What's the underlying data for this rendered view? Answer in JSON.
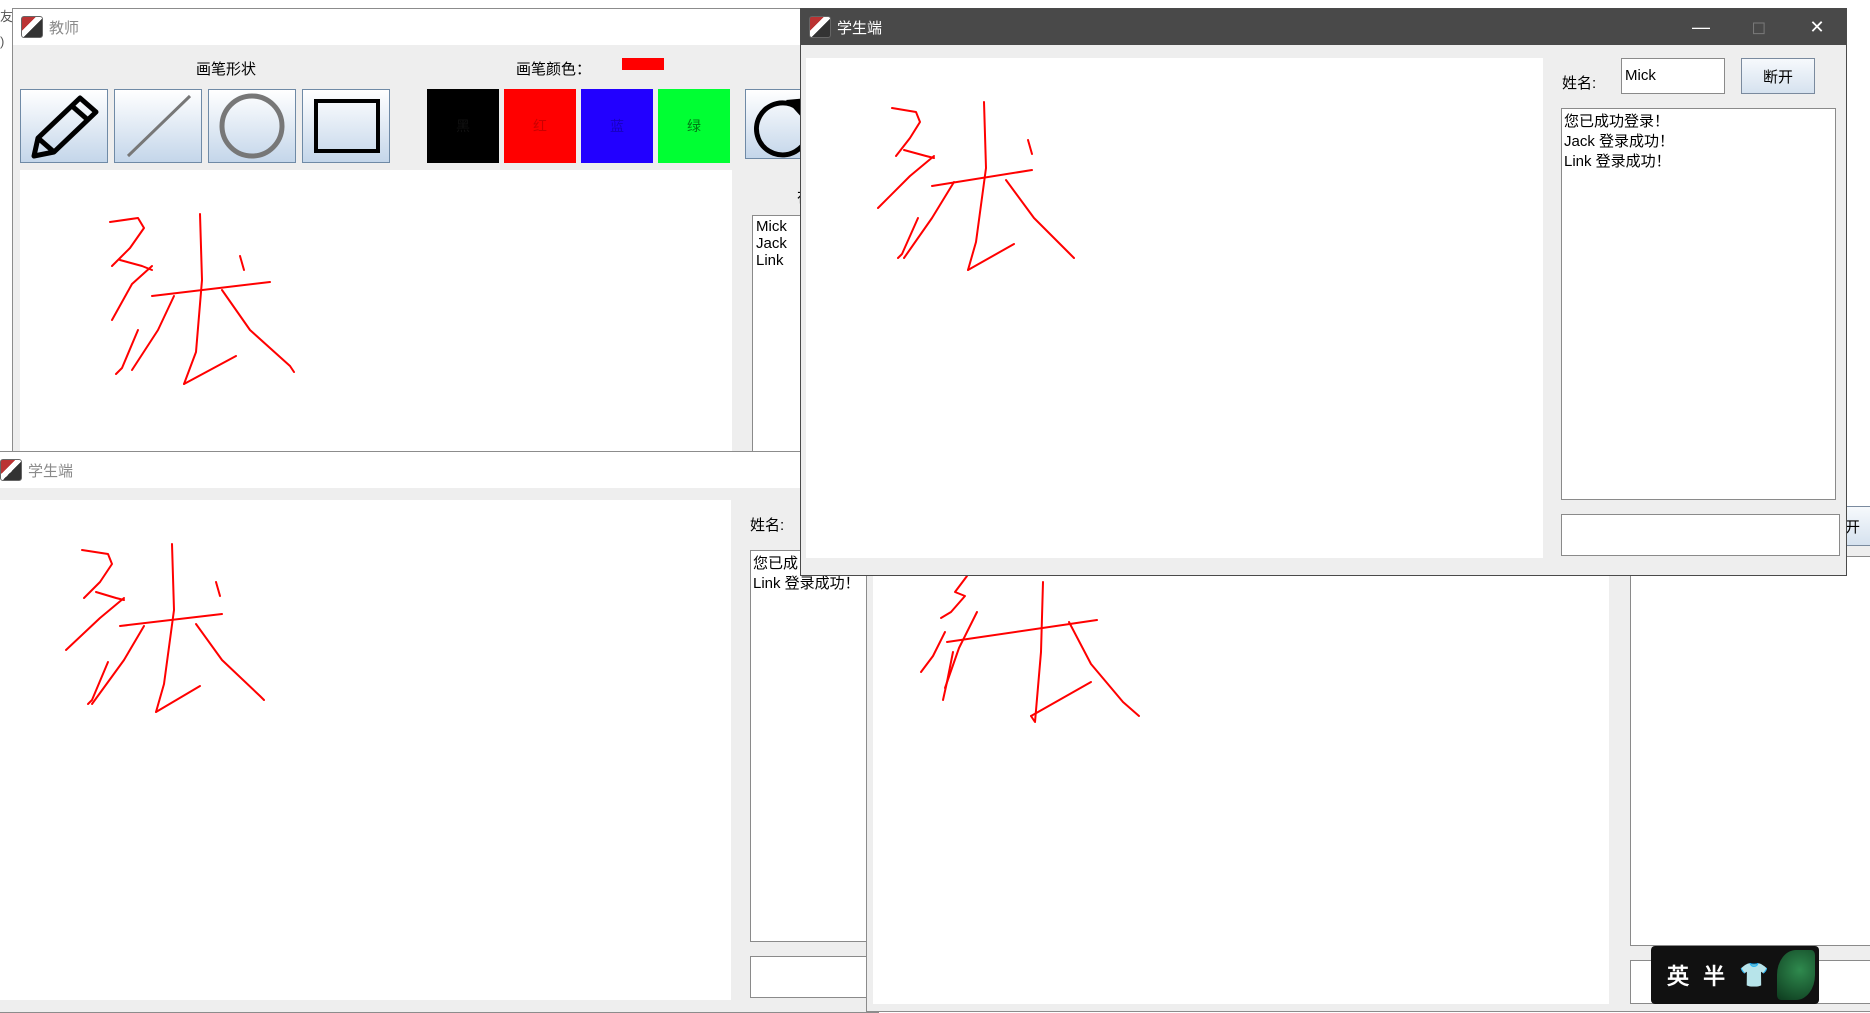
{
  "desktop": {
    "edge_text_1": "友",
    "edge_text_2": ")"
  },
  "teacher": {
    "title": "教师",
    "brush_shape_label": "画笔形状",
    "brush_color_label": "画笔颜色：",
    "current_color": "#ff0000",
    "tools": [
      "pencil",
      "line",
      "circle",
      "rectangle"
    ],
    "colors": [
      {
        "label": "黑",
        "hex": "#000000"
      },
      {
        "label": "红",
        "hex": "#ff0000"
      },
      {
        "label": "蓝",
        "hex": "#2200ff"
      },
      {
        "label": "绿",
        "hex": "#00ff33"
      }
    ],
    "online_list": [
      "Mick",
      "Jack",
      "Link"
    ],
    "partial_label": "在"
  },
  "student_front": {
    "title": "学生端",
    "name_label": "姓名:",
    "name_value": "Mick",
    "disconnect_label": "断开",
    "log": [
      "您已成功登录！",
      "Jack 登录成功！",
      "Link 登录成功！"
    ],
    "message_input": ""
  },
  "student_back": {
    "title": "学生端",
    "name_label": "姓名:",
    "log": [
      "您已成",
      "Link 登录成功！"
    ]
  },
  "student_third": {
    "partial_button": "开"
  },
  "badge": {
    "text": "英 半"
  }
}
